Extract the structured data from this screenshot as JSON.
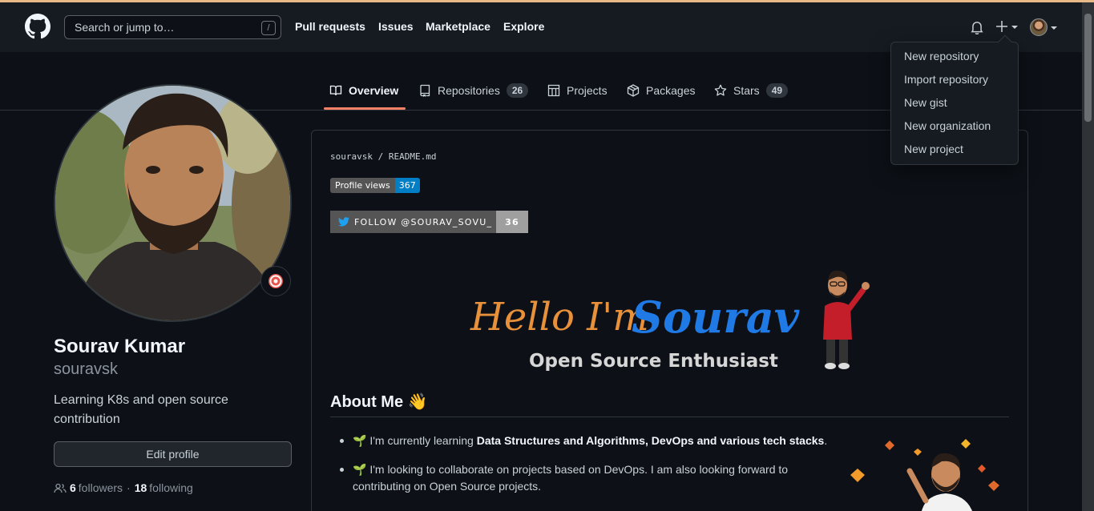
{
  "header": {
    "search_placeholder": "Search or jump to…",
    "search_shortcut": "/",
    "nav": [
      "Pull requests",
      "Issues",
      "Marketplace",
      "Explore"
    ]
  },
  "create_menu": {
    "items": [
      "New repository",
      "Import repository",
      "New gist",
      "New organization",
      "New project"
    ]
  },
  "tabs": [
    {
      "label": "Overview",
      "count": null,
      "active": true
    },
    {
      "label": "Repositories",
      "count": "26",
      "active": false
    },
    {
      "label": "Projects",
      "count": null,
      "active": false
    },
    {
      "label": "Packages",
      "count": null,
      "active": false
    },
    {
      "label": "Stars",
      "count": "49",
      "active": false
    }
  ],
  "profile": {
    "name": "Sourav Kumar",
    "login": "souravsk",
    "bio": "Learning K8s and open source contribution",
    "edit_label": "Edit profile",
    "followers_count": "6",
    "followers_label": "followers",
    "separator": "·",
    "following_count": "18",
    "following_label": "following"
  },
  "readme": {
    "path_user": "souravsk",
    "path_sep": "/",
    "path_file": "README.md",
    "badge_views_label": "Profile views",
    "badge_views_value": "367",
    "badge_follow_label": "FOLLOW @SOURAV_SOVU_",
    "badge_follow_value": "36",
    "banner_hello": "Hello I'm",
    "banner_name": "Sourav",
    "banner_tagline": "Open Source Enthusiast",
    "about_title": "About Me",
    "about_emoji": "👋",
    "bullets": [
      {
        "emoji": "🌱",
        "pre": "I'm currently learning ",
        "bold": "Data Structures and Algorithms, DevOps and various tech stacks",
        "post": "."
      },
      {
        "emoji": "🌱",
        "line1": "I'm looking to collaborate on projects based on DevOps. I am also looking forward to",
        "line2": "contributing on Open Source projects."
      }
    ]
  },
  "colors": {
    "bg": "#0d1117",
    "header_bg": "#161b22",
    "accent_tab": "#f78166",
    "badge_blue": "#007ec6",
    "banner_orange": "#e8913a",
    "banner_blue": "#1f7ae6"
  }
}
